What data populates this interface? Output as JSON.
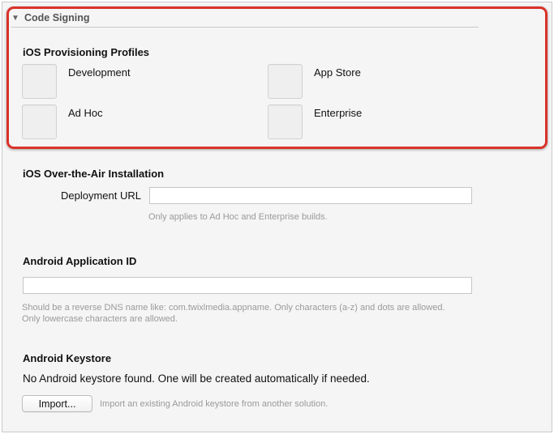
{
  "code_signing": {
    "section_title": "Code Signing",
    "provisioning_heading": "iOS Provisioning Profiles",
    "profiles": {
      "development": "Development",
      "app_store": "App Store",
      "ad_hoc": "Ad Hoc",
      "enterprise": "Enterprise"
    }
  },
  "ota": {
    "heading": "iOS Over-the-Air Installation",
    "url_label": "Deployment URL",
    "url_value": "",
    "hint": "Only applies to Ad Hoc and Enterprise builds."
  },
  "android_id": {
    "heading": "Android Application ID",
    "value": "",
    "hint_line1": "Should be a reverse DNS name like: com.twixlmedia.appname. Only characters (a-z) and dots are allowed.",
    "hint_line2": "Only lowercase characters are allowed."
  },
  "keystore": {
    "heading": "Android Keystore",
    "status": "No Android keystore found. One will be created automatically if needed.",
    "import_label": "Import...",
    "import_hint": "Import an existing Android keystore from another solution."
  },
  "colors": {
    "highlight": "#d93229"
  },
  "icons": {
    "disclosure": "disclosure-triangle-down-icon"
  }
}
